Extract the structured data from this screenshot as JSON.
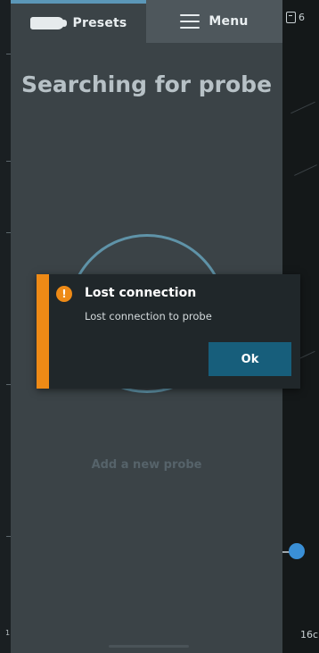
{
  "header": {
    "presets_label": "Presets",
    "menu_label": "Menu"
  },
  "main": {
    "title": "Searching for probe",
    "add_probe_label": "Add a new probe"
  },
  "side_view": {
    "top_value": "6",
    "depth_label": "16c"
  },
  "left_strip": {
    "bottom_label": "1"
  },
  "dialog": {
    "title": "Lost connection",
    "message": "Lost connection to probe",
    "ok_label": "Ok",
    "icon": "exclamation-icon"
  },
  "colors": {
    "accent_warning": "#ee8a16",
    "ok_button": "#175e7b",
    "tab_indicator": "#5b97b8",
    "slider_knob": "#3a8fd6"
  }
}
